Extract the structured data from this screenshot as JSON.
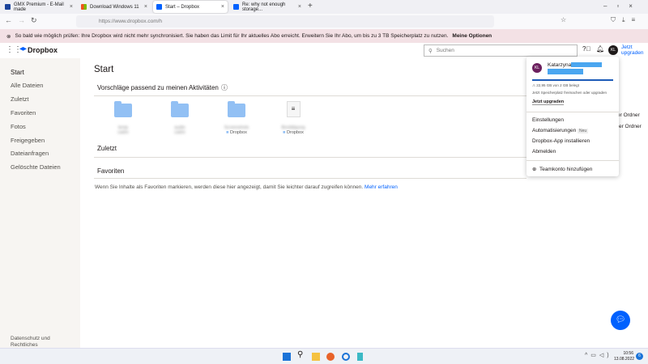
{
  "browser": {
    "tabs": [
      {
        "title": "GMX Premium - E-Mail made"
      },
      {
        "title": "Download Windows 11"
      },
      {
        "title": "Start – Dropbox"
      },
      {
        "title": "Re: why not enough storage..."
      }
    ],
    "url": "https://www.dropbox.com/h"
  },
  "banner": {
    "text": "So bald wie möglich prüfen: Ihre Dropbox wird nicht mehr synchronisiert. Sie haben das Limit für Ihr aktuelles Abo erreicht. Erweitern Sie Ihr Abo, um bis zu 3 TB Speicherplatz zu nutzen.",
    "link": "Meine Optionen"
  },
  "header": {
    "logo": "Dropbox",
    "search_placeholder": "Suchen",
    "avatar": "KL",
    "upgrade": "Jetzt upgraden"
  },
  "sidebar": {
    "items": [
      "Start",
      "Alle Dateien",
      "Zuletzt",
      "Favoriten",
      "Fotos",
      "Freigegeben",
      "Dateianfragen",
      "Gelöschte Dateien"
    ],
    "footer": "Datenschutz und Rechtliches"
  },
  "main": {
    "title": "Start",
    "suggestions": "Vorschläge passend zu meinen Aktivitäten",
    "tiles": [
      {
        "name": "temp",
        "loc": "cadre"
      },
      {
        "name": "audio",
        "loc": "cadre"
      },
      {
        "name": "Screenshots",
        "loc": "Dropbox"
      },
      {
        "name": "Bestätigung",
        "loc": "Dropbox"
      }
    ],
    "recent": "Zuletzt",
    "favorites": "Favoriten",
    "fav_msg": "Wenn Sie Inhalte als Favoriten markieren, werden diese hier angezeigt, damit Sie leichter darauf zugreifen können.",
    "fav_link": "Mehr erfahren",
    "behind1": "er Ordner",
    "behind2": "rter Ordner"
  },
  "menu": {
    "avatar": "KL",
    "name": "Katarzyna",
    "storage": "22,95 GB von 2 GB belegt",
    "storage_fraction": 1.0,
    "hint": "Jetzt Speicherplatz freimachen oder upgraden",
    "upgrade": "Jetzt upgraden",
    "items": [
      "Einstellungen",
      "Automatisierungen",
      "Dropbox-App installieren",
      "Abmelden"
    ],
    "badge": "Neu",
    "team": "Teamkonto hinzufügen"
  },
  "taskbar": {
    "time": "10:56",
    "date": "13.08.2022",
    "notif": "6"
  },
  "colors": {
    "accent": "#0061fe",
    "banner": "#f3e1e5",
    "avatar": "#6b1f5d"
  }
}
